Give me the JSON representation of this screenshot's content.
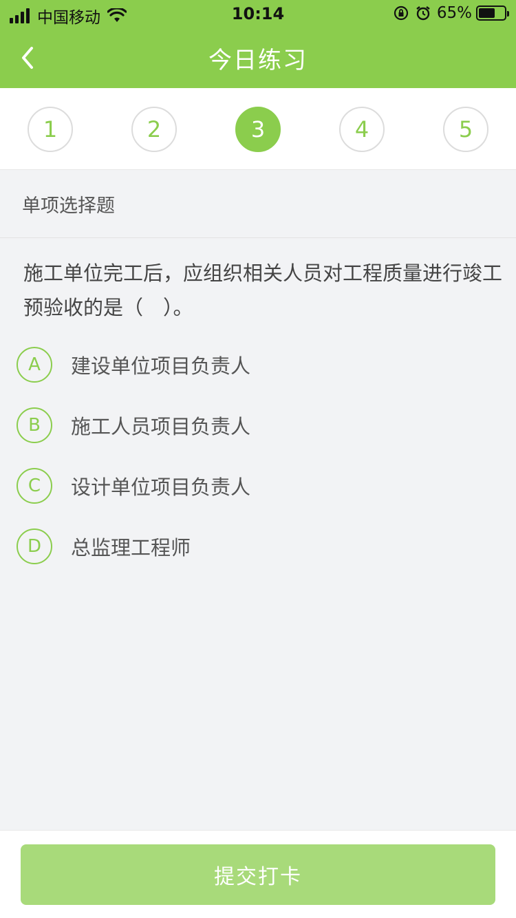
{
  "status_bar": {
    "carrier": "中国移动",
    "time": "10:14",
    "battery_pct": "65%",
    "battery_level": 0.65
  },
  "nav": {
    "title": "今日练习",
    "back_icon": "chevron-left-icon"
  },
  "steps": {
    "items": [
      "1",
      "2",
      "3",
      "4",
      "5"
    ],
    "active": "3"
  },
  "section": {
    "title": "单项选择题"
  },
  "question": {
    "text": "施工单位完工后，应组织相关人员对工程质量进行竣工预验收的是（　）。",
    "options": [
      {
        "letter": "A",
        "text": "建设单位项目负责人"
      },
      {
        "letter": "B",
        "text": "施工人员项目负责人"
      },
      {
        "letter": "C",
        "text": "设计单位项目负责人"
      },
      {
        "letter": "D",
        "text": "总监理工程师"
      }
    ]
  },
  "footer": {
    "submit_label": "提交打卡"
  },
  "colors": {
    "accent": "#8bcd4d",
    "submit_bg": "#a8da7a",
    "background": "#f2f3f5"
  }
}
